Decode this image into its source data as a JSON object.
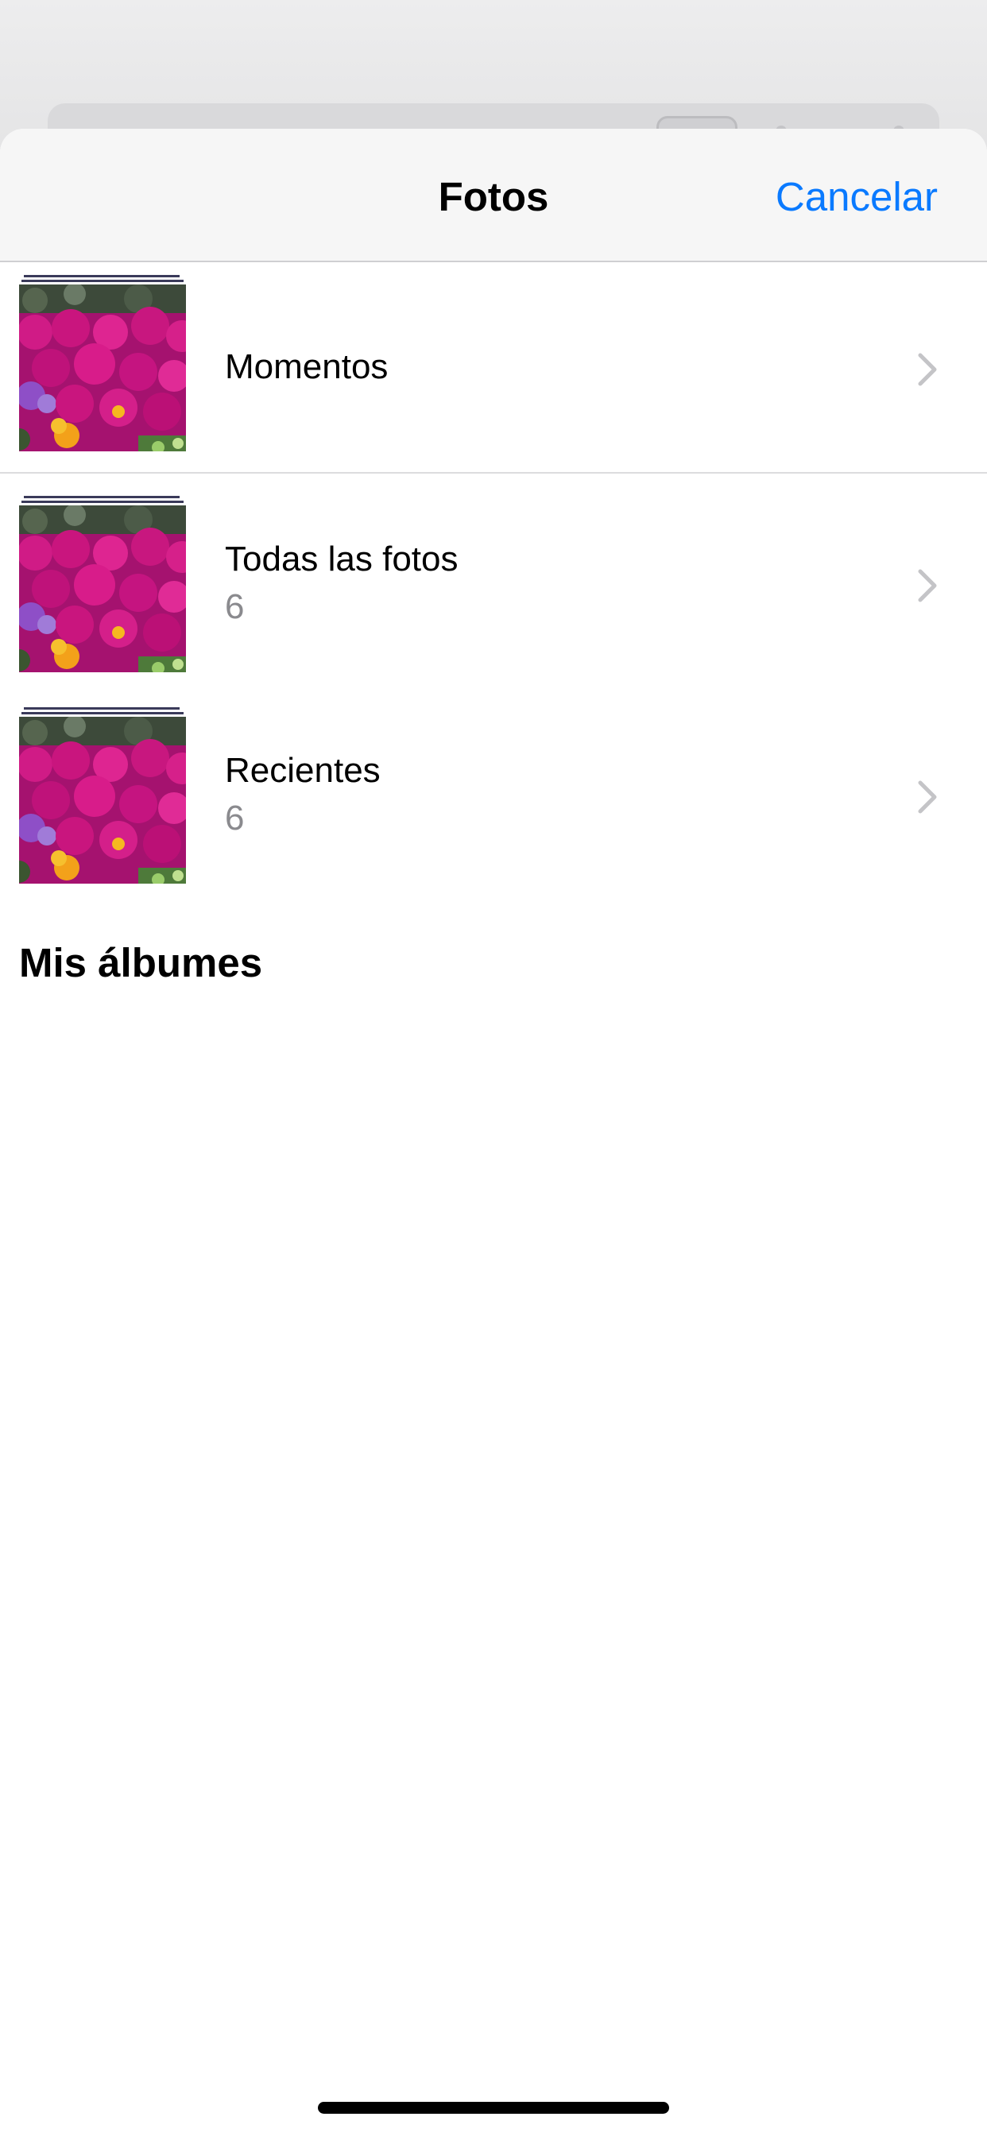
{
  "navbar": {
    "title": "Fotos",
    "cancel_label": "Cancelar"
  },
  "albums": [
    {
      "title": "Momentos",
      "count": ""
    },
    {
      "title": "Todas las fotos",
      "count": "6"
    },
    {
      "title": "Recientes",
      "count": "6"
    }
  ],
  "section": {
    "title": "Mis álbumes"
  },
  "icons": {
    "chevron": "chevron-right-icon",
    "thumbnail": "flower-photo-thumbnail"
  },
  "colors": {
    "accent": "#0a7aff",
    "secondary_text": "#8a8a8e",
    "chevron": "#c4c4c7"
  }
}
